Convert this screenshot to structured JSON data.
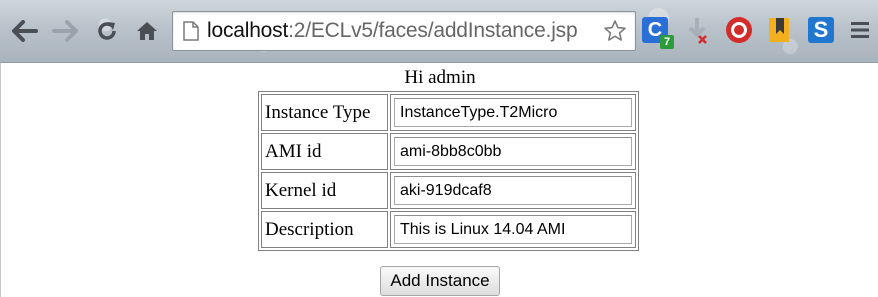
{
  "browser": {
    "url_host": "localhost",
    "url_path": ":2/ECLv5/faces/addInstance.jsp",
    "icons": {
      "back": "arrow-left-icon",
      "forward": "arrow-right-icon",
      "reload": "reload-icon",
      "home": "home-icon",
      "page": "page-icon",
      "bookmark": "star-icon",
      "menu": "hamburger-menu-icon"
    },
    "extensions": [
      {
        "name": "c-extension-icon",
        "label": "C",
        "badge": "7",
        "color": "#2a6fd6"
      },
      {
        "name": "download-extension-icon",
        "color": "#b0b8c0"
      },
      {
        "name": "stop-extension-icon",
        "color": "#d42b2b"
      },
      {
        "name": "bookmark-extension-icon",
        "color": "#f2b01e"
      },
      {
        "name": "s-extension-icon",
        "label": "S",
        "color": "#1f77d0"
      }
    ]
  },
  "page": {
    "greeting": "Hi admin",
    "form": {
      "rows": [
        {
          "label": "Instance Type",
          "value": "InstanceType.T2Micro"
        },
        {
          "label": "AMI id",
          "value": "ami-8bb8c0bb"
        },
        {
          "label": "Kernel id",
          "value": "aki-919dcaf8"
        },
        {
          "label": "Description",
          "value": "This is Linux 14.04 AMI"
        }
      ],
      "submit_label": "Add Instance"
    }
  }
}
